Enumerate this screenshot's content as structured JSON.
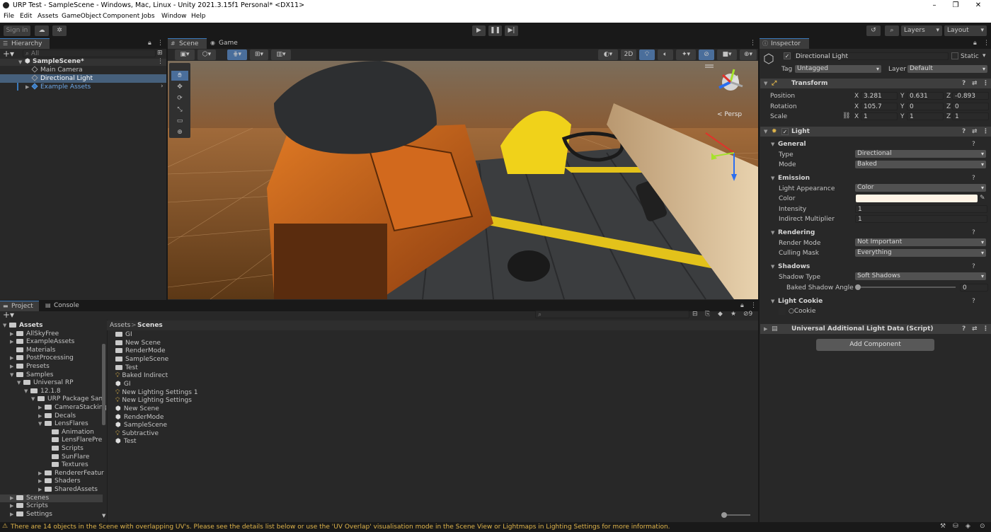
{
  "window": {
    "title": "URP Test - SampleScene - Windows, Mac, Linux - Unity 2021.3.15f1 Personal* <DX11>",
    "minimize": "–",
    "maximize": "❐",
    "close": "✕"
  },
  "menu": [
    "File",
    "Edit",
    "Assets",
    "GameObject",
    "Component",
    "Jobs",
    "Window",
    "Help"
  ],
  "toolbar": {
    "signin": "Sign in",
    "layers": "Layers",
    "layout": "Layout"
  },
  "hierarchy": {
    "tab": "Hierarchy",
    "search_placeholder": "All",
    "scene": "SampleScene*",
    "items": [
      "Main Camera",
      "Directional Light",
      "Example Assets"
    ]
  },
  "scene_view": {
    "tabs": [
      "Scene",
      "Game"
    ],
    "mode_2d": "2D",
    "persp": "< Persp"
  },
  "inspector": {
    "tab": "Inspector",
    "object_name": "Directional Light",
    "static_label": "Static",
    "tag_label": "Tag",
    "tag_value": "Untagged",
    "layer_label": "Layer",
    "layer_value": "Default",
    "transform": {
      "title": "Transform",
      "position": {
        "label": "Position",
        "x": "3.281",
        "y": "0.631",
        "z": "-0.893"
      },
      "rotation": {
        "label": "Rotation",
        "x": "105.7",
        "y": "0",
        "z": "0"
      },
      "scale": {
        "label": "Scale",
        "x": "1",
        "y": "1",
        "z": "1"
      }
    },
    "light": {
      "title": "Light",
      "general": "General",
      "type_label": "Type",
      "type_value": "Directional",
      "mode_label": "Mode",
      "mode_value": "Baked",
      "emission": "Emission",
      "appearance_label": "Light Appearance",
      "appearance_value": "Color",
      "color_label": "Color",
      "color_hex": "#fff4e6",
      "intensity_label": "Intensity",
      "intensity_value": "1",
      "indirect_label": "Indirect Multiplier",
      "indirect_value": "1",
      "rendering": "Rendering",
      "render_mode_label": "Render Mode",
      "render_mode_value": "Not Important",
      "culling_label": "Culling Mask",
      "culling_value": "Everything",
      "shadows": "Shadows",
      "shadow_type_label": "Shadow Type",
      "shadow_type_value": "Soft Shadows",
      "baked_angle_label": "Baked Shadow Angle",
      "baked_angle_value": "0",
      "cookie": "Light Cookie",
      "cookie_label": "Cookie"
    },
    "urp": "Universal Additional Light Data (Script)",
    "add_component": "Add Component"
  },
  "project": {
    "tabs": [
      "Project",
      "Console"
    ],
    "breadcrumb_root": "Assets",
    "breadcrumb_sep": ">",
    "breadcrumb_leaf": "Scenes",
    "badge": "9",
    "tree": [
      {
        "label": "Assets",
        "lvl": 0,
        "fold": "▼",
        "bold": true
      },
      {
        "label": "AllSkyFree",
        "lvl": 1,
        "fold": "▶"
      },
      {
        "label": "ExampleAssets",
        "lvl": 1,
        "fold": "▶"
      },
      {
        "label": "Materials",
        "lvl": 1,
        "fold": ""
      },
      {
        "label": "PostProcessing",
        "lvl": 1,
        "fold": "▶"
      },
      {
        "label": "Presets",
        "lvl": 1,
        "fold": "▶"
      },
      {
        "label": "Samples",
        "lvl": 1,
        "fold": "▼"
      },
      {
        "label": "Universal RP",
        "lvl": 2,
        "fold": "▼"
      },
      {
        "label": "12.1.8",
        "lvl": 3,
        "fold": "▼"
      },
      {
        "label": "URP Package Sam",
        "lvl": 4,
        "fold": "▼"
      },
      {
        "label": "CameraStacking",
        "lvl": 5,
        "fold": "▶"
      },
      {
        "label": "Decals",
        "lvl": 5,
        "fold": "▶"
      },
      {
        "label": "LensFlares",
        "lvl": 5,
        "fold": "▼"
      },
      {
        "label": "Animation",
        "lvl": 6,
        "fold": ""
      },
      {
        "label": "LensFlarePre",
        "lvl": 6,
        "fold": ""
      },
      {
        "label": "Scripts",
        "lvl": 6,
        "fold": ""
      },
      {
        "label": "SunFlare",
        "lvl": 6,
        "fold": ""
      },
      {
        "label": "Textures",
        "lvl": 6,
        "fold": ""
      },
      {
        "label": "RendererFeatur",
        "lvl": 5,
        "fold": "▶"
      },
      {
        "label": "Shaders",
        "lvl": 5,
        "fold": "▶"
      },
      {
        "label": "SharedAssets",
        "lvl": 5,
        "fold": "▶"
      },
      {
        "label": "Scenes",
        "lvl": 1,
        "fold": "▶",
        "selected": true
      },
      {
        "label": "Scripts",
        "lvl": 1,
        "fold": "▶"
      },
      {
        "label": "Settings",
        "lvl": 1,
        "fold": "▶"
      }
    ],
    "files": [
      {
        "label": "GI",
        "icon": "folder"
      },
      {
        "label": "New Scene",
        "icon": "folder"
      },
      {
        "label": "RenderMode",
        "icon": "folder"
      },
      {
        "label": "SampleScene",
        "icon": "folder"
      },
      {
        "label": "Test",
        "icon": "folder"
      },
      {
        "label": "Baked Indirect",
        "icon": "bulb"
      },
      {
        "label": "GI",
        "icon": "unity"
      },
      {
        "label": "New Lighting Settings 1",
        "icon": "bulb"
      },
      {
        "label": "New Lighting Settings",
        "icon": "bulb"
      },
      {
        "label": "New Scene",
        "icon": "unity"
      },
      {
        "label": "RenderMode",
        "icon": "unity"
      },
      {
        "label": "SampleScene",
        "icon": "unity"
      },
      {
        "label": "Subtractive",
        "icon": "bulb"
      },
      {
        "label": "Test",
        "icon": "unity"
      }
    ]
  },
  "status": {
    "message": "There are 14 objects in the Scene with overlapping UV's. Please see the details list below or use the 'UV Overlap' visualisation mode in the Scene View or Lightmaps in Lighting Settings for more information."
  }
}
